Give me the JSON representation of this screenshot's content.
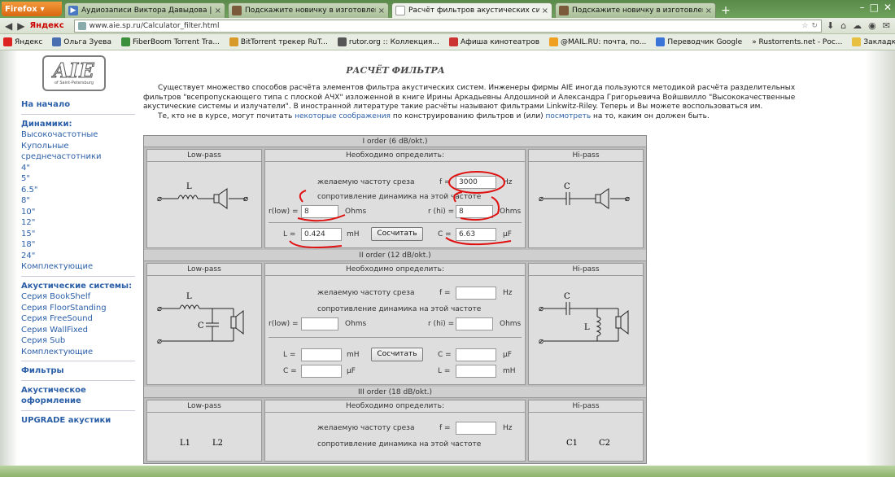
{
  "browser": {
    "app_button": "Firefox",
    "tabs": [
      {
        "title": "Аудиозаписи Виктора Давыдова | 2..."
      },
      {
        "title": "Подскажите новичку в изготовлени..."
      },
      {
        "title": "Расчёт фильтров акустических сист..."
      },
      {
        "title": "Подскажите новичку в изготовлени..."
      }
    ],
    "url": "www.aie.sp.ru/Calculator_filter.html",
    "search_engine": "Яндекс",
    "bookmarks": [
      "Яндекс",
      "Ольга Зуева",
      "FiberBoom Torrent Tra...",
      "BitTorrent трекер RuT...",
      "rutor.org :: Коллекция...",
      "Афиша кинотеатров",
      "@MAIL.RU: почта, по...",
      "Переводчик Google",
      "» Rustorrents.net - Рос..."
    ],
    "bookmarks_right": "Закладки"
  },
  "site": {
    "logo_text": "AIE",
    "logo_sub": "of Saint-Petersburg",
    "sidebar": {
      "home": "На начало",
      "speakers_head": "Динамики:",
      "speakers": [
        "Высокочастотные",
        "Купольные",
        "среднечастотники",
        "4\"",
        "5\"",
        "6.5\"",
        "8\"",
        "10\"",
        "12\"",
        "15\"",
        "18\"",
        "24\"",
        "Комплектующие"
      ],
      "systems_head": "Акустические системы:",
      "systems": [
        "Серия BookShelf",
        "Серия FloorStanding",
        "Серия FreeSound",
        "Серия WallFixed",
        "Серия Sub",
        "Комплектующие"
      ],
      "filters": "Фильтры",
      "acoustic_design_1": "Акустическое",
      "acoustic_design_2": "оформление",
      "upgrade": "UPGRADE акустики"
    },
    "title": "РАСЧЁТ ФИЛЬТРА",
    "intro_1": "Существует множество способов расчёта элементов фильтра акустических систем. Инженеры фирмы AIE иногда пользуются методикой расчёта разделительных фильтров \"всепропускающего типа с плоской АЧХ\" изложенной в книге Ирины Аркадьевны Алдошиной и Александра Григорьевича Войшвилло \"Высококачественные акустические системы и излучатели\". В иностранной литературе такие расчёты называют фильтрами Linkwitz-Riley. Теперь и Вы можете воспользоваться им.",
    "intro_2_a": "Те, кто не в курсе, могут почитать ",
    "intro_2_link1": "некоторые соображения",
    "intro_2_b": " по конструированию фильтров и (или) ",
    "intro_2_link2": "посмотреть",
    "intro_2_c": " на то, каким он должен быть."
  },
  "calc": {
    "lowpass": "Low-pass",
    "hipass": "Hi-pass",
    "need": "Необходимо определить:",
    "freq_label": "желаемую частоту среза",
    "f_eq": "f =",
    "hz": "Hz",
    "res_label": "сопротивление динамика на этой частоте",
    "rlow": "r(low) =",
    "rhi": "r (hi) =",
    "ohms": "Ohms",
    "L_eq": "L =",
    "C_eq": "C =",
    "mH": "mH",
    "uF": "μF",
    "calc_btn": "Сосчитать",
    "order1": {
      "title": "I order (6 dB/okt.)",
      "f": "3000",
      "rlow": "8",
      "rhi": "8",
      "L": "0.424",
      "C": "6.63"
    },
    "order2": {
      "title": "II order (12 dB/okt.)"
    },
    "order3": {
      "title": "III order (18 dB/okt.)"
    },
    "schem_L": "L",
    "schem_C": "C",
    "schem_L1": "L1",
    "schem_L2": "L2",
    "schem_C1": "C1",
    "schem_C2": "C2"
  },
  "colors": {
    "link": "#2b5fa8",
    "annotation": "#e01010",
    "panel": "#dedede"
  }
}
